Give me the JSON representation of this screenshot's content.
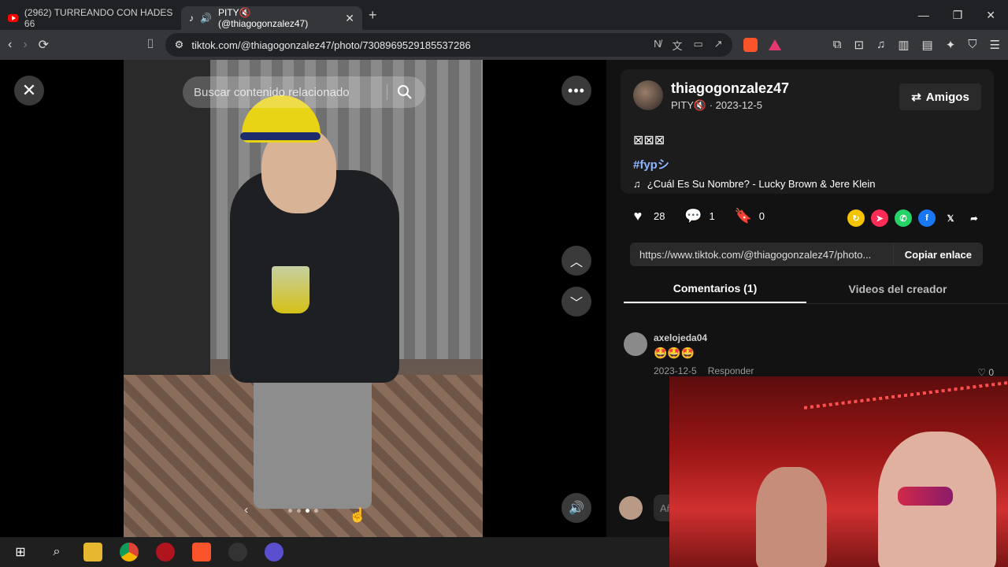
{
  "browser": {
    "tabs": [
      {
        "title": "(2962) TURREANDO CON HADES 66",
        "active": false
      },
      {
        "title": "PITY🔇 (@thiagogonzalez47)",
        "active": true
      }
    ],
    "new_tab": "+",
    "url": "tiktok.com/@thiagogonzalez47/photo/7308969529185537286"
  },
  "viewer": {
    "search_placeholder": "Buscar contenido relacionado",
    "close_label": "✕",
    "more_label": "•••"
  },
  "post": {
    "username": "thiagogonzalez47",
    "nickname": "PITY🔇",
    "date": "2023-12-5",
    "friends_label": "Amigos",
    "caption": "⊠⊠⊠",
    "hashtag": "#fypシ",
    "music": "¿Cuál Es Su Nombre? - Lucky Brown & Jere Klein",
    "likes": "28",
    "comments": "1",
    "saves": "0",
    "link": "https://www.tiktok.com/@thiagogonzalez47/photo...",
    "copy_label": "Copiar enlace"
  },
  "panel_tabs": {
    "comments": "Comentarios (1)",
    "creator_videos": "Videos del creador"
  },
  "comment": {
    "user": "axelojeda04",
    "text": "🤩🤩🤩",
    "date": "2023-12-5",
    "reply": "Responder",
    "likes": "0"
  },
  "comment_input": {
    "placeholder": "Añ"
  },
  "colors": {
    "panel_bg": "#121212",
    "hashtag": "#8eb6ff",
    "youtube_red": "#ff0000"
  }
}
